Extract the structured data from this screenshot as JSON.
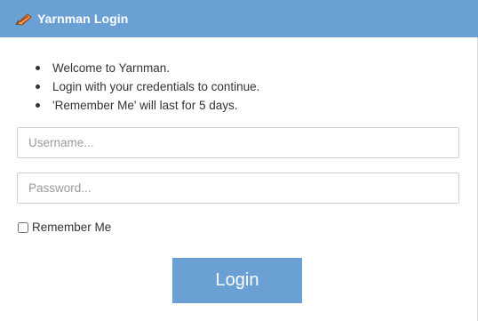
{
  "header": {
    "title": "Yarnman Login",
    "icon": "yarn-ball-icon"
  },
  "info": {
    "items": [
      "Welcome to Yarnman.",
      "Login with your credentials to continue.",
      "'Remember Me' will last for 5 days."
    ]
  },
  "form": {
    "username": {
      "value": "",
      "placeholder": "Username..."
    },
    "password": {
      "value": "",
      "placeholder": "Password..."
    },
    "remember_label": "Remember Me",
    "remember_checked": false,
    "login_label": "Login"
  },
  "colors": {
    "accent": "#6aa0d4",
    "text": "#333333",
    "placeholder": "#9a9a9a",
    "border": "#cfcfcf"
  }
}
